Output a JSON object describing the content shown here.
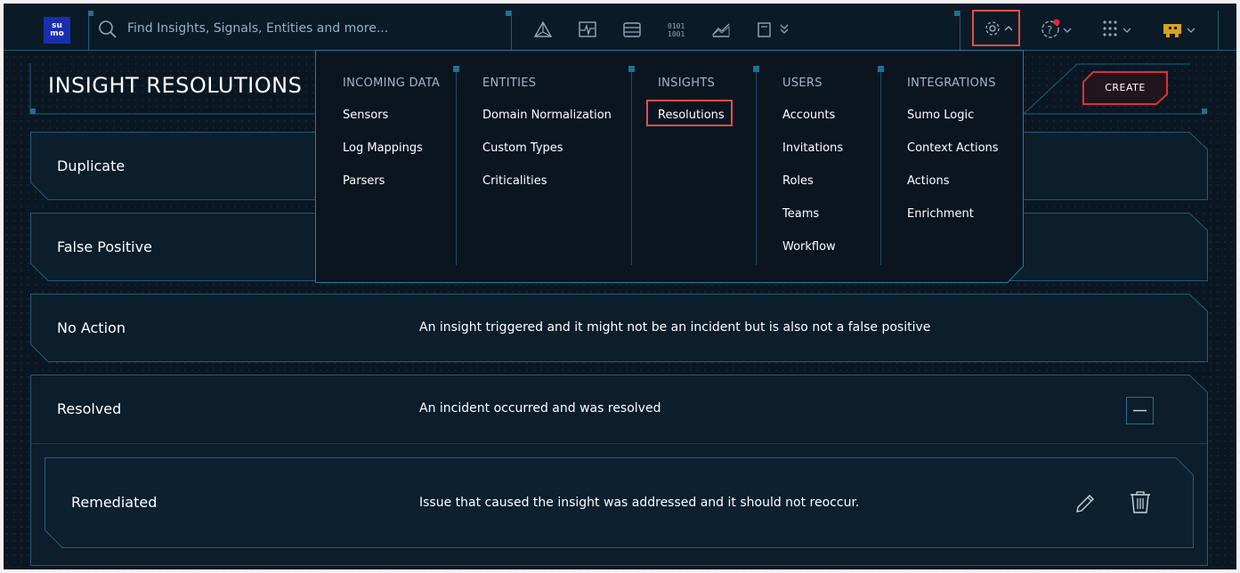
{
  "app": {
    "logo_text": "su mo"
  },
  "search": {
    "placeholder": "Find Insights, Signals, Entities and more..."
  },
  "nav_icons": [
    "insights-icon",
    "signals-icon",
    "records-icon",
    "entities-icon",
    "analytics-icon",
    "content-icon"
  ],
  "page": {
    "title": "INSIGHT RESOLUTIONS",
    "create_label": "CREATE"
  },
  "menu": {
    "columns": [
      {
        "heading": "INCOMING DATA",
        "items": [
          "Sensors",
          "Log Mappings",
          "Parsers"
        ]
      },
      {
        "heading": "ENTITIES",
        "items": [
          "Domain Normalization",
          "Custom Types",
          "Criticalities"
        ]
      },
      {
        "heading": "INSIGHTS",
        "items": [
          "Resolutions"
        ]
      },
      {
        "heading": "USERS",
        "items": [
          "Accounts",
          "Invitations",
          "Roles",
          "Teams",
          "Workflow"
        ]
      },
      {
        "heading": "INTEGRATIONS",
        "items": [
          "Sumo Logic",
          "Context Actions",
          "Actions",
          "Enrichment"
        ]
      }
    ],
    "selected": "Resolutions"
  },
  "resolutions": [
    {
      "name": "Duplicate",
      "description": ""
    },
    {
      "name": "False Positive",
      "description": ""
    },
    {
      "name": "No Action",
      "description": "An insight triggered and it might not be an incident but is also not a false positive"
    },
    {
      "name": "Resolved",
      "description": "An incident occurred and was resolved",
      "expanded": true,
      "children": [
        {
          "name": "Remediated",
          "description": "Issue that caused the insight was addressed and it should not reoccur."
        }
      ]
    }
  ],
  "colors": {
    "accent": "#2a8db5",
    "highlight": "#e0504a",
    "background": "#0a1622",
    "create_border": "#d8313d"
  }
}
